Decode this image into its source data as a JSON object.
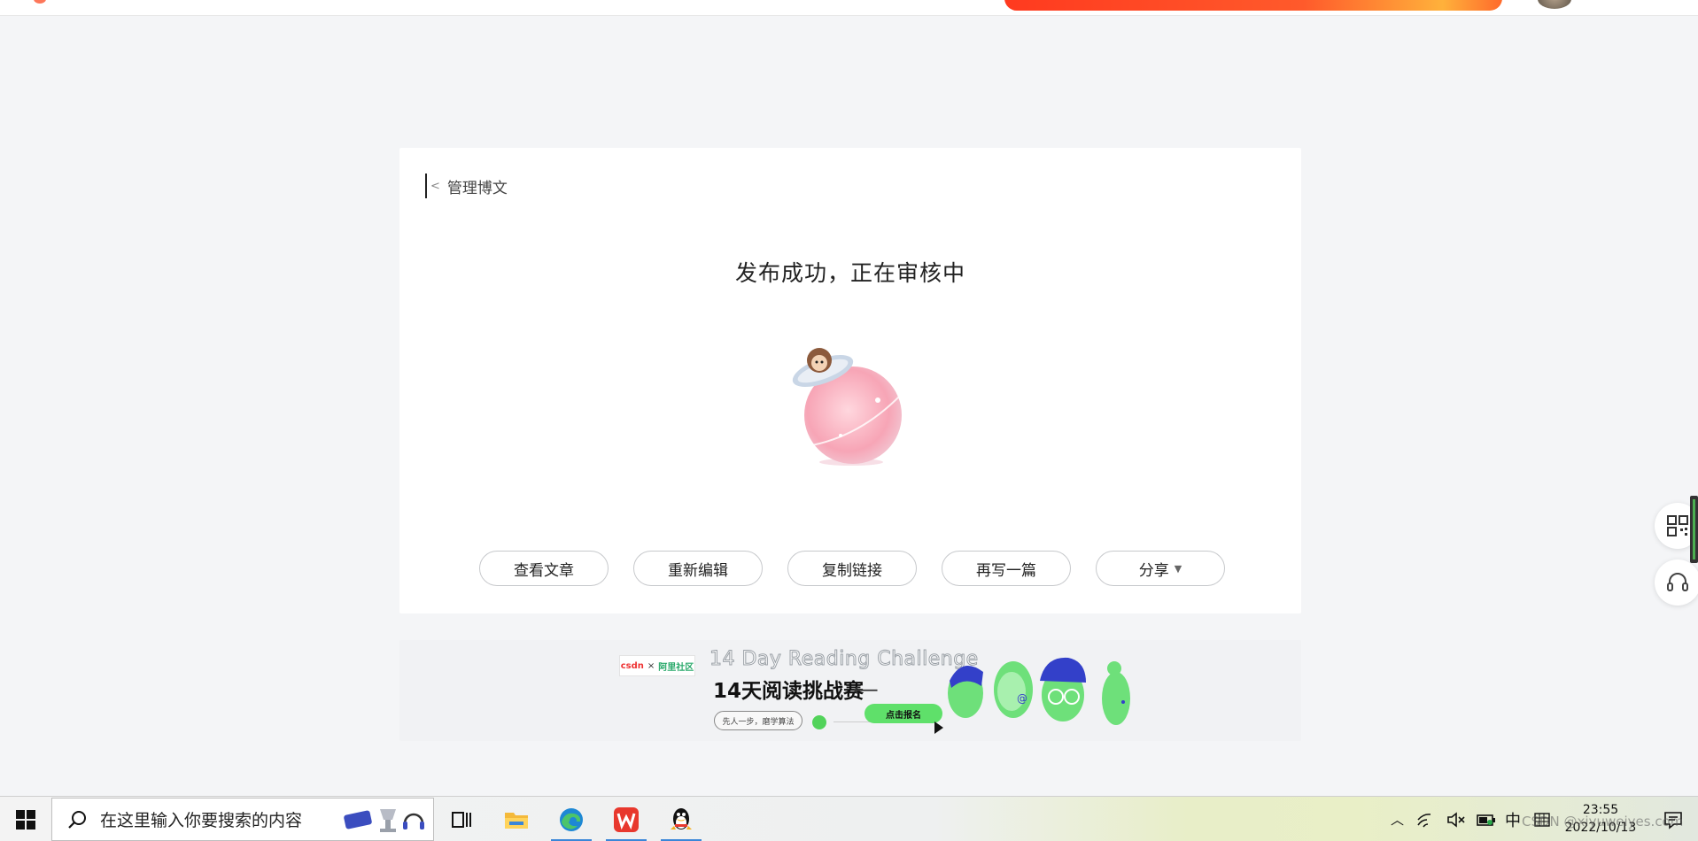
{
  "page": {
    "back_label": "管理博文",
    "status_title": "发布成功，正在审核中",
    "actions": [
      {
        "label": "查看文章"
      },
      {
        "label": "重新编辑"
      },
      {
        "label": "复制链接"
      },
      {
        "label": "再写一篇"
      },
      {
        "label": "分享"
      }
    ]
  },
  "ad": {
    "brand_left": "csdn",
    "brand_x": "×",
    "brand_right": "阿里社区",
    "title_en": "14 Day Reading Challenge",
    "title_cn": "14天阅读挑战赛",
    "arrow": "⟵",
    "tag": "先人一步，磨学算法",
    "cta": "点击报名"
  },
  "taskbar": {
    "search_placeholder": "在这里输入你要搜索的内容",
    "ime": "中",
    "time": "23:55",
    "date": "2022/10/13",
    "watermark": "CSDN @xiyuweiyes.com",
    "apps": [
      "task-view",
      "file-explorer",
      "edge",
      "wps",
      "qq"
    ]
  },
  "colors": {
    "accent": "#fc5531",
    "taskbar_active": "#3a86d8",
    "ad_cta": "#5fe06a"
  },
  "icons": [
    "chevron-left-icon",
    "qr-code-icon",
    "headset-icon",
    "windows-icon",
    "search-icon",
    "wifi-icon",
    "volume-muted-icon",
    "battery-icon",
    "notification-icon"
  ]
}
